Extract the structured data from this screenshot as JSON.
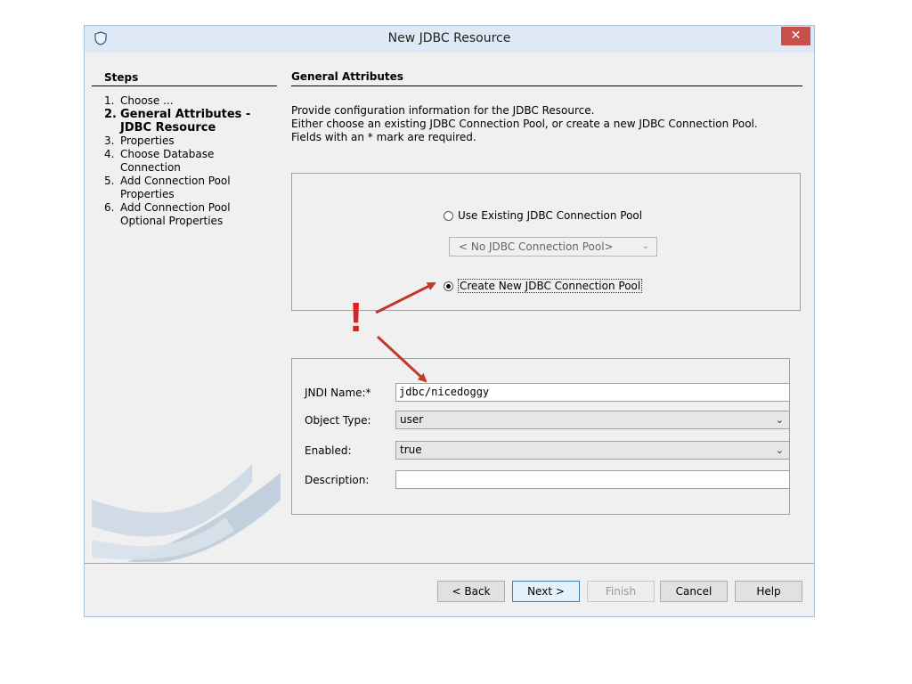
{
  "window": {
    "title": "New JDBC Resource",
    "close_glyph": "✕"
  },
  "steps": {
    "heading": "Steps",
    "items": [
      {
        "num": "1.",
        "label": "Choose ..."
      },
      {
        "num": "2.",
        "label": "General Attributes - JDBC Resource"
      },
      {
        "num": "3.",
        "label": "Properties"
      },
      {
        "num": "4.",
        "label": "Choose Database Connection"
      },
      {
        "num": "5.",
        "label": "Add Connection Pool Properties"
      },
      {
        "num": "6.",
        "label": "Add Connection Pool Optional Properties"
      }
    ],
    "current_index": 1
  },
  "content": {
    "heading": "General Attributes",
    "desc_line1": "Provide configuration information for the JDBC Resource.",
    "desc_line2": "Either choose an existing JDBC Connection Pool, or create a new JDBC Connection Pool.",
    "desc_line3": "Fields with an * mark are required."
  },
  "pool": {
    "use_existing_label": "Use Existing JDBC Connection Pool",
    "existing_pool_value": "< No JDBC Connection Pool>",
    "create_new_label": "Create New JDBC Connection Pool",
    "selected": "create_new"
  },
  "form": {
    "jndi_label": "JNDI Name:*",
    "jndi_value": "jdbc/nicedoggy",
    "object_type_label": "Object Type:",
    "object_type_value": "user",
    "enabled_label": "Enabled:",
    "enabled_value": "true",
    "description_label": "Description:",
    "description_value": ""
  },
  "buttons": {
    "back": "< Back",
    "next": "Next >",
    "finish": "Finish",
    "cancel": "Cancel",
    "help": "Help"
  },
  "annotation": {
    "mark": "!",
    "color": "#e02020",
    "arrow_color": "#c0392b"
  },
  "icons": {
    "app": "shield-icon",
    "chevron": "chevron-down-icon"
  }
}
